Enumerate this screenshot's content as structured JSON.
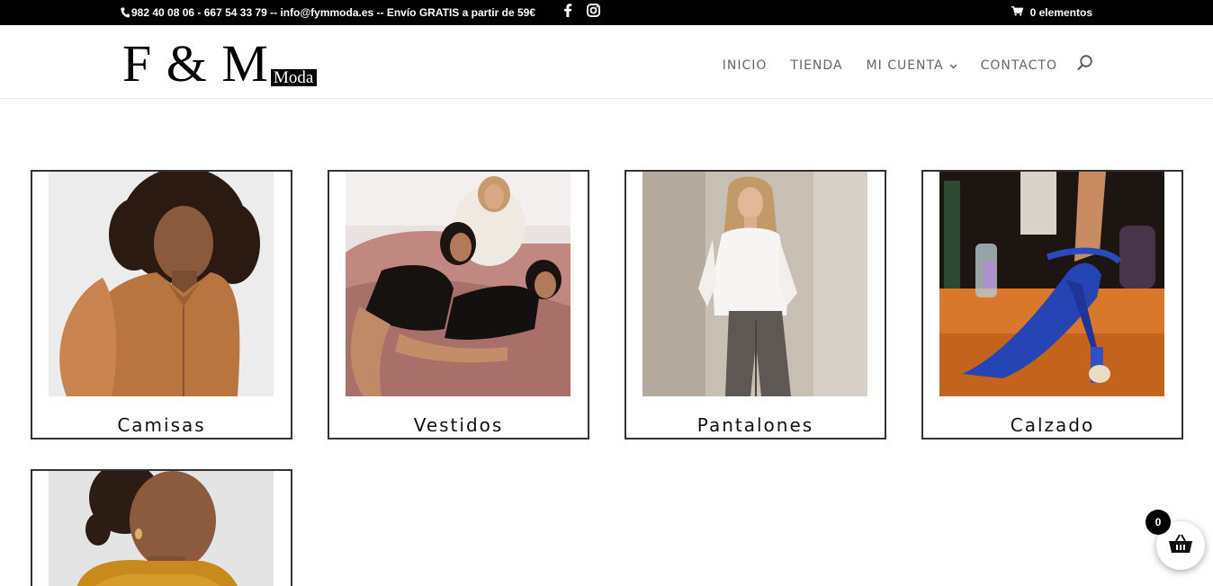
{
  "topbar": {
    "contact_text": "982 40 08 06 - 667 54 33 79 -- info@fymmoda.es -- Envío GRATIS a partir de 59€",
    "phone_icon": "phone-icon",
    "social_icons": [
      "facebook-icon",
      "instagram-icon"
    ],
    "cart_text": "0 elementos",
    "cart_icon": "cart-icon"
  },
  "header": {
    "logo_main": "F & M",
    "logo_sub": "Moda",
    "nav": [
      {
        "label": "INICIO"
      },
      {
        "label": "TIENDA"
      },
      {
        "label": "MI CUENTA",
        "has_dropdown": true
      },
      {
        "label": "CONTACTO"
      }
    ],
    "search_icon": "search-icon"
  },
  "categories": [
    {
      "label": "Camisas",
      "image": "woman-in-brown-blouse-photo"
    },
    {
      "label": "Vestidos",
      "image": "women-in-black-dresses-on-sofa-photo"
    },
    {
      "label": "Pantalones",
      "image": "woman-in-white-shirt-and-grey-trousers-photo"
    },
    {
      "label": "Calzado",
      "image": "blue-satin-heel-shoe-photo"
    },
    {
      "label": "",
      "image": "woman-in-mustard-knit-sweater-photo"
    }
  ],
  "floating_cart": {
    "count": "0",
    "icon": "basket-icon"
  },
  "colors": {
    "topbar_bg": "#000000",
    "nav_text": "#666666",
    "card_border": "#333333"
  }
}
